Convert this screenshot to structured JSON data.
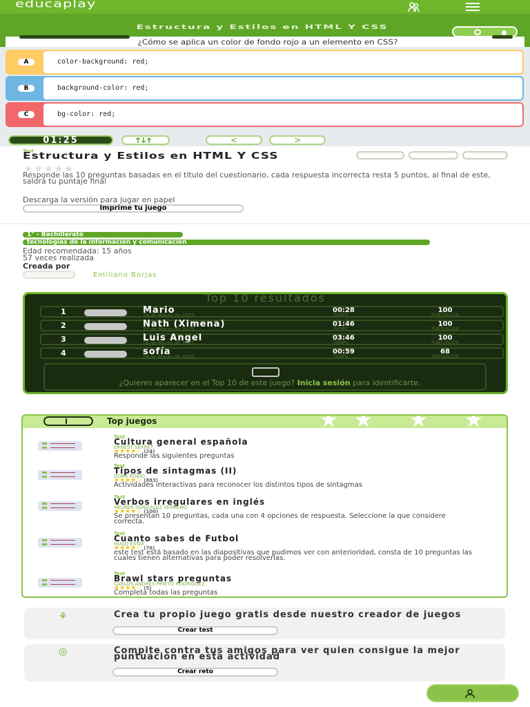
{
  "header": {
    "logo": "educaplay"
  },
  "game": {
    "title": "Estructura y Estilos en HTML Y CSS",
    "question": "¿Cómo se aplica un color de fondo rojo a un elemento en CSS?",
    "options": [
      {
        "letter": "A",
        "text": "color-background: red;",
        "color": "#ffcb64"
      },
      {
        "letter": "B",
        "text": "background-color: red;",
        "color": "#6fb6e3"
      },
      {
        "letter": "C",
        "text": "bg-color: red;",
        "color": "#f0686a"
      }
    ],
    "timer": "01:25",
    "prev_label": "<",
    "next_label": ">"
  },
  "activity": {
    "type_label": "Test",
    "title": "Estructura y Estilos en HTML Y CSS",
    "description": "Responde las 10 preguntas basadas en el título del cuestionario, cada respuesta incorrecta resta 5 puntos, al final de este, saldrá tu puntaje final",
    "download_text": "Descarga la versión para jugar en papel",
    "print_button": "Imprime tu juego",
    "level_tag": "1° - Bachillerato",
    "subject_tag": "tecnologías de la información y comunicación",
    "age": "Edad recomendada: 15 años",
    "plays": "57 veces realizada",
    "created_by_label": "Creada por",
    "author": "Emiliano Borjas"
  },
  "top10": {
    "title": "Top 10 resultados",
    "rows": [
      {
        "rank": "1",
        "name": "Mario",
        "date": "28 de Marzo de 2025",
        "time": "00:28",
        "time_label": "TIEMPO",
        "score": "100",
        "score_label": "PUNTUACIÓN"
      },
      {
        "rank": "2",
        "name": "Nath (Ximena)",
        "date": "27 de Marzo de 2025",
        "time": "01:46",
        "time_label": "TIEMPO",
        "score": "100",
        "score_label": "PUNTUACIÓN"
      },
      {
        "rank": "3",
        "name": "Luis Angel",
        "date": "26 de Marzo de 2025",
        "time": "03:46",
        "time_label": "TIEMPO",
        "score": "100",
        "score_label": "PUNTUACIÓN"
      },
      {
        "rank": "4",
        "name": "sofía",
        "date": "28 de Marzo de 2025",
        "time": "00:59",
        "time_label": "TIEMPO",
        "score": "68",
        "score_label": "PUNTUACIÓN"
      }
    ],
    "invite_text": "¿Quieres aparecer en el Top 10 de este juego?",
    "invite_link": "Inicia sesión",
    "invite_tail": "para identificarte."
  },
  "top_games": {
    "title": "Top juegos",
    "items": [
      {
        "type": "Test",
        "title": "Cultura general española",
        "author": "ERNEST SERRET",
        "stars": "★★★★☆",
        "count": "(24)",
        "desc": "Responde las siguientes preguntas"
      },
      {
        "type": "Test",
        "title": "Tipos de sintagmas (II)",
        "author": "DORA RUBIO",
        "stars": "★★★★☆",
        "count": "(883)",
        "desc": "Actividades interactivas para reconocer los distintos tipos de sintagmas"
      },
      {
        "type": "Test",
        "title": "Verbos irregulares en inglés",
        "author": "HELMER GONZALEZ SERRANO",
        "stars": "★★★★☆",
        "count": "(100)",
        "desc": "Se presentan 10 preguntas, cada una con 4 opciones de respuesta. Seleccione la que considere correcta."
      },
      {
        "type": "Test",
        "title": "Cuanto sabes de Futbol",
        "author": "HUGO ESTAY",
        "stars": "★★★★☆",
        "count": "(76)",
        "desc": "este test está basado en las diapositivas que pudimos ver con anterioridad, consta de 10 preguntas las cuales tienen alternativas para poder resolverlas."
      },
      {
        "type": "Test",
        "title": "Brawl stars preguntas",
        "author": "CARLOS ANDRES PRIETO RODRIGUEZ",
        "stars": "★★★★☆",
        "count": "(5)",
        "desc": "Completa todas las preguntas"
      }
    ]
  },
  "cta": {
    "create_text": "Crea tu propio juego gratis desde nuestro creador de juegos",
    "create_button": "Crear test",
    "challenge_text": "Compite contra tus amigos para ver quien consigue la mejor puntuación en esta actividad",
    "challenge_button": "Crear reto"
  },
  "colors": {
    "brand": "#6fb62d",
    "dark": "#1a2c10"
  }
}
